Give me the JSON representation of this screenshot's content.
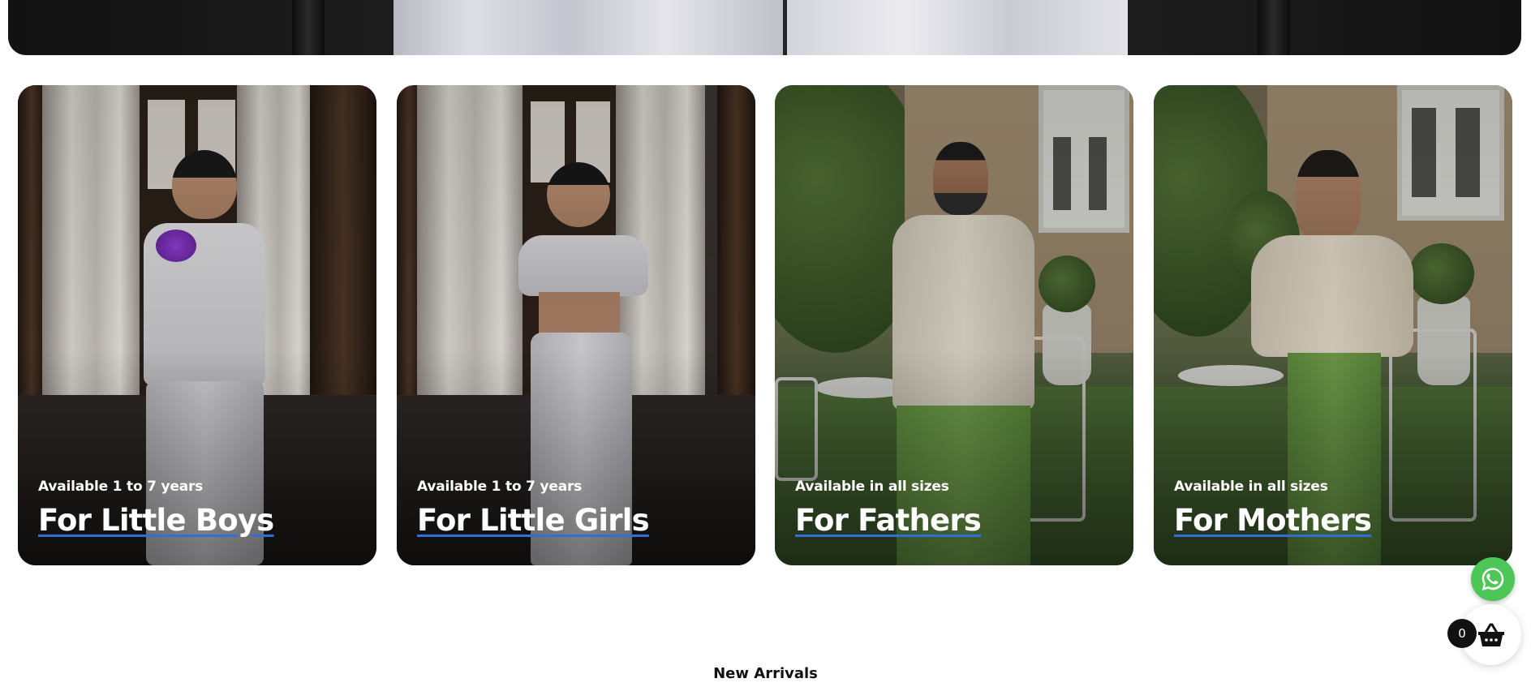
{
  "categories": [
    {
      "subtitle": "Available 1 to 7 years",
      "title": "For Little Boys"
    },
    {
      "subtitle": "Available 1 to 7 years",
      "title": "For Little Girls"
    },
    {
      "subtitle": "Available in all sizes",
      "title": "For Fathers"
    },
    {
      "subtitle": "Available in all sizes",
      "title": "For Mothers"
    }
  ],
  "floating": {
    "whatsapp_icon": "whatsapp-icon",
    "cart_icon": "basket-icon",
    "cart_count": "0"
  },
  "sections": {
    "new_arrivals_title": "New Arrivals"
  },
  "colors": {
    "title_underline": "#2f6fd9",
    "whatsapp_green": "#4bc657"
  }
}
